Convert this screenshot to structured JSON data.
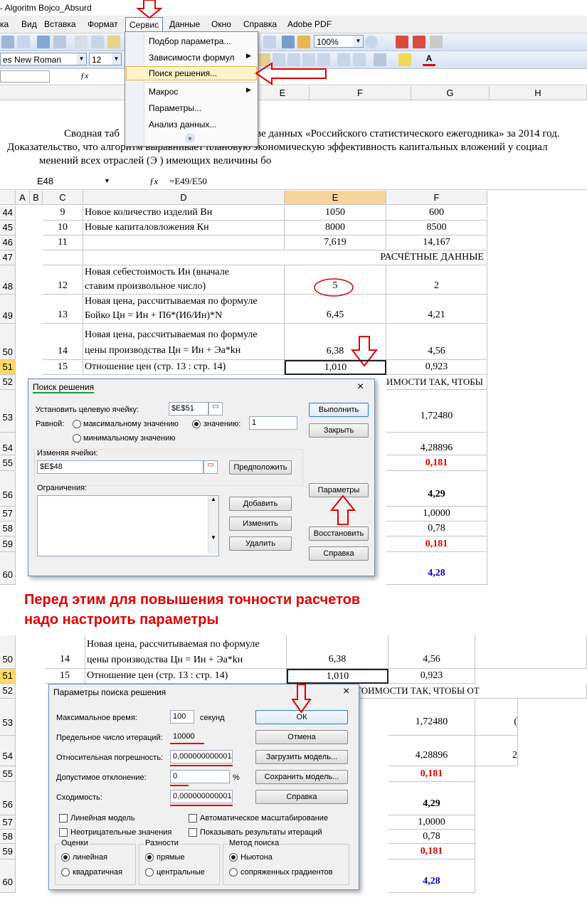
{
  "window_title": "- Algoritm Bojco_Absurd",
  "menubar": [
    "ка",
    "Вид",
    "Вставка",
    "Формат",
    "Сервис",
    "Данные",
    "Окно",
    "Справка",
    "Adobe PDF"
  ],
  "toolbar": {
    "zoom": "100%",
    "font": "es New Roman",
    "size": "12"
  },
  "service_menu": [
    "Подбор параметра...",
    "Зависимости формул",
    "Поиск решения...",
    "Макрос",
    "Параметры...",
    "Анализ данных..."
  ],
  "sheet1": {
    "columns": [
      "D",
      "E",
      "F",
      "G",
      "H"
    ],
    "text_line1": "Сводная таб",
    "text_line1_rest": "ве данных «Российского статистического ежегодника» за 2014 год.",
    "text_line2": "Доказательство, что алгоритм выравнивает плановую экономическую эффективность капитальных вложений у социал",
    "text_line3": "менений всех отраслей (Э ) имеющих величины бо"
  },
  "sheet2": {
    "namebox": "E48",
    "formula": "=E49/E50",
    "fx": "fx",
    "columns": [
      "A",
      "B",
      "C",
      "D",
      "E",
      "F"
    ],
    "rows": [
      {
        "n": "44",
        "c": "9",
        "d": "Новое количество изделий Вн",
        "e": "1050",
        "f": "600"
      },
      {
        "n": "45",
        "c": "10",
        "d": "Новые капиталовложения Кн",
        "e": "8000",
        "f": "8500"
      },
      {
        "n": "46",
        "c": "11",
        "d": "",
        "e": "7,619",
        "f": "14,167"
      },
      {
        "n": "47",
        "c": "",
        "d": "",
        "e": "",
        "f": "РАСЧЁТНЫЕ ДАННЫЕ"
      },
      {
        "n": "48",
        "c": "12",
        "d1": "Новая себестоимость Ин (вначале",
        "d2": "ставим произвольное число)",
        "e": "5",
        "f": "2"
      },
      {
        "n": "49",
        "c": "13",
        "d1": "Новая цена, рассчитываемая по формуле",
        "d2": "Бойко  Цн = Ин + П6*(И6/Ин)*N",
        "e": "6,45",
        "f": "4,21"
      },
      {
        "n": "50",
        "c": "14",
        "d1": "Новая цена, рассчитываемая по формуле",
        "d2": "цены производства   Цн = Ин + Эа*kн",
        "e": "6,38",
        "f": "4,56"
      },
      {
        "n": "51",
        "c": "15",
        "d": "Отношение цен (стр. 13 : стр. 14)",
        "e": "1,010",
        "f": "0,923"
      },
      {
        "n": "52",
        "f": "ИМОСТИ ТАК, ЧТОБЫ"
      },
      {
        "n": "53",
        "f": "1,72480"
      },
      {
        "n": "54",
        "f": "4,28896"
      },
      {
        "n": "55",
        "f": "0,181"
      },
      {
        "n": "56",
        "f": "4,29"
      },
      {
        "n": "57",
        "f": "1,0000"
      },
      {
        "n": "58",
        "f": "0,78"
      },
      {
        "n": "59",
        "f": "0,181"
      },
      {
        "n": "60",
        "f": "4,28"
      }
    ]
  },
  "solver": {
    "title": "Поиск решения",
    "target_label": "Установить целевую ячейку:",
    "target_value": "$E$51",
    "equal_label": "Равной:",
    "opt_max": "максимальному значению",
    "opt_value": "значению:",
    "value": "1",
    "opt_min": "минимальному значению",
    "changing_label": "Изменяя ячейки:",
    "changing_value": "$E$48",
    "guess": "Предположить",
    "constraints_label": "Ограничения:",
    "add": "Добавить",
    "change": "Изменить",
    "delete": "Удалить",
    "run": "Выполнить",
    "close": "Закрыть",
    "params": "Параметры",
    "restore": "Восстановить",
    "help": "Справка",
    "close_icon": "×"
  },
  "caption_line1": "Перед этим для повышения точности расчетов",
  "caption_line2": "надо настроить параметры",
  "sheet3": {
    "rows": [
      {
        "n": "50",
        "c": "14",
        "d1": "Новая цена, рассчитываемая по формуле",
        "d2": "цены производства   Цн = Ин + Эа*kн",
        "e": "6,38",
        "f": "4,56"
      },
      {
        "n": "51",
        "c": "15",
        "d": "Отношение цен (стр. 13 : стр. 14)",
        "e": "1,010",
        "f": "0,923"
      },
      {
        "n": "52",
        "f": "ТОИМОСТИ ТАК, ЧТОБЫ ОТ"
      },
      {
        "n": "53",
        "f": "1,72480",
        "g": "("
      },
      {
        "n": "54",
        "f": "4,28896",
        "g": "2"
      },
      {
        "n": "55",
        "f": "0,181"
      },
      {
        "n": "56",
        "f": "4,29"
      },
      {
        "n": "57",
        "f": "1,0000"
      },
      {
        "n": "58",
        "f": "0,78"
      },
      {
        "n": "59",
        "f": "0,181"
      },
      {
        "n": "60",
        "f": "4,28"
      }
    ]
  },
  "params_dialog": {
    "title": "Параметры поиска решения",
    "max_time_label": "Максимальное время:",
    "max_time": "100",
    "seconds": "секунд",
    "iter_label": "Предельное число итераций:",
    "iter": "10000",
    "precision_label": "Относительная погрешность:",
    "precision": "0,000000000001",
    "tolerance_label": "Допустимое отклонение:",
    "tolerance": "0",
    "percent": "%",
    "convergence_label": "Сходимость:",
    "convergence": "0,000000000001",
    "ok": "ОК",
    "cancel": "Отмена",
    "load": "Загрузить модель...",
    "save": "Сохранить модель...",
    "help": "Справка",
    "linear": "Линейная модель",
    "autoscale": "Автоматическое масштабирование",
    "nonneg": "Неотрицательные значения",
    "show_iter": "Показывать результаты итераций",
    "est_title": "Оценки",
    "est1": "линейная",
    "est2": "квадратичная",
    "diff_title": "Разности",
    "diff1": "прямые",
    "diff2": "центральные",
    "method_title": "Метод поиска",
    "method1": "Ньютона",
    "method2": "сопряженных градиентов",
    "close_icon": "×"
  },
  "colors": {
    "accent_red": "#e00000",
    "bold_red": "#e00000",
    "bold_blue": "#0000cc"
  }
}
